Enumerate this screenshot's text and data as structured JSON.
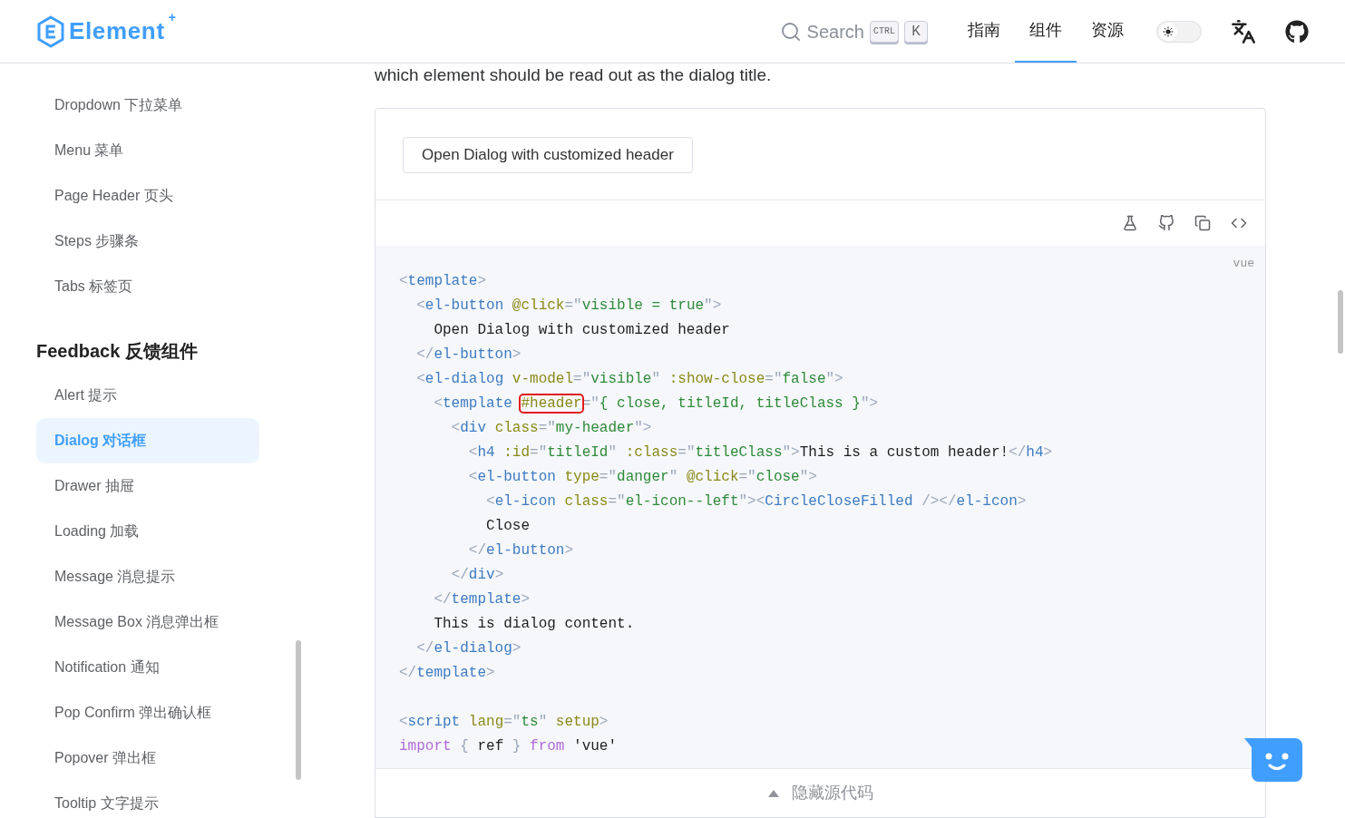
{
  "header": {
    "logo": "Element",
    "logo_mark": "+",
    "search": {
      "label": "Search",
      "keys": [
        "CTRL",
        "K"
      ]
    },
    "nav": [
      {
        "label": "指南",
        "selected": false
      },
      {
        "label": "组件",
        "selected": true
      },
      {
        "label": "资源",
        "selected": false
      }
    ],
    "theme_switch": {
      "on": false
    }
  },
  "sidebar": {
    "sections": [
      {
        "items": [
          {
            "label": "Dropdown 下拉菜单",
            "selected": false
          },
          {
            "label": "Menu 菜单",
            "selected": false
          },
          {
            "label": "Page Header 页头",
            "selected": false
          },
          {
            "label": "Steps 步骤条",
            "selected": false
          },
          {
            "label": "Tabs 标签页",
            "selected": false
          }
        ]
      },
      {
        "title": "Feedback 反馈组件",
        "items": [
          {
            "label": "Alert 提示",
            "selected": false
          },
          {
            "label": "Dialog 对话框",
            "selected": true
          },
          {
            "label": "Drawer 抽屉",
            "selected": false
          },
          {
            "label": "Loading 加载",
            "selected": false
          },
          {
            "label": "Message 消息提示",
            "selected": false
          },
          {
            "label": "Message Box 消息弹出框",
            "selected": false
          },
          {
            "label": "Notification 通知",
            "selected": false
          },
          {
            "label": "Pop Confirm 弹出确认框",
            "selected": false
          },
          {
            "label": "Popover 弹出框",
            "selected": false
          },
          {
            "label": "Tooltip 文字提示",
            "selected": false
          }
        ]
      }
    ]
  },
  "intro": "which element should be read out as the dialog title.",
  "demo": {
    "button": "Open Dialog with customized header",
    "language": "vue",
    "footer": "隐藏源代码",
    "code": [
      {
        "kind": "code",
        "tokens": [
          {
            "kind": "punct",
            "text": "<"
          },
          {
            "kind": "tag",
            "text": "template"
          },
          {
            "kind": "punct",
            "text": ">"
          }
        ]
      },
      {
        "kind": "code",
        "tokens": [
          {
            "kind": "punct",
            "text": "  <"
          },
          {
            "kind": "tag",
            "text": "el-button"
          },
          {
            "kind": "attr",
            "text": " @click"
          },
          {
            "kind": "punct",
            "text": "=\""
          },
          {
            "kind": "string",
            "text": "visible = true"
          },
          {
            "kind": "punct",
            "text": "\">"
          }
        ]
      },
      {
        "kind": "code",
        "tokens": [
          {
            "kind": "text",
            "text": "    Open Dialog with customized header"
          }
        ]
      },
      {
        "kind": "code",
        "tokens": [
          {
            "kind": "punct",
            "text": "  </"
          },
          {
            "kind": "tag",
            "text": "el-button"
          },
          {
            "kind": "punct",
            "text": ">"
          }
        ]
      },
      {
        "kind": "code",
        "tokens": [
          {
            "kind": "punct",
            "text": "  <"
          },
          {
            "kind": "tag",
            "text": "el-dialog"
          },
          {
            "kind": "attr",
            "text": " v-model"
          },
          {
            "kind": "punct",
            "text": "=\""
          },
          {
            "kind": "string",
            "text": "visible"
          },
          {
            "kind": "punct",
            "text": "\""
          },
          {
            "kind": "attr",
            "text": " :show-close"
          },
          {
            "kind": "punct",
            "text": "=\""
          },
          {
            "kind": "string",
            "text": "false"
          },
          {
            "kind": "punct",
            "text": "\">"
          }
        ]
      },
      {
        "kind": "code",
        "tokens": [
          {
            "kind": "punct",
            "text": "    <"
          },
          {
            "kind": "tag",
            "text": "template "
          },
          {
            "kind": "attr",
            "text": "#header",
            "boxed": true
          },
          {
            "kind": "punct",
            "text": "=\""
          },
          {
            "kind": "string",
            "text": "{ close, titleId, titleClass }"
          },
          {
            "kind": "punct",
            "text": "\">"
          }
        ]
      },
      {
        "kind": "code",
        "tokens": [
          {
            "kind": "punct",
            "text": "      <"
          },
          {
            "kind": "tag",
            "text": "div"
          },
          {
            "kind": "attr",
            "text": " class"
          },
          {
            "kind": "punct",
            "text": "=\""
          },
          {
            "kind": "string",
            "text": "my-header"
          },
          {
            "kind": "punct",
            "text": "\">"
          }
        ]
      },
      {
        "kind": "code",
        "tokens": [
          {
            "kind": "punct",
            "text": "        <"
          },
          {
            "kind": "tag",
            "text": "h4"
          },
          {
            "kind": "attr",
            "text": " :id"
          },
          {
            "kind": "punct",
            "text": "=\""
          },
          {
            "kind": "string",
            "text": "titleId"
          },
          {
            "kind": "punct",
            "text": "\""
          },
          {
            "kind": "attr",
            "text": " :class"
          },
          {
            "kind": "punct",
            "text": "=\""
          },
          {
            "kind": "string",
            "text": "titleClass"
          },
          {
            "kind": "punct",
            "text": "\">"
          },
          {
            "kind": "text",
            "text": "This is a custom header!"
          },
          {
            "kind": "punct",
            "text": "</"
          },
          {
            "kind": "tag",
            "text": "h4"
          },
          {
            "kind": "punct",
            "text": ">"
          }
        ]
      },
      {
        "kind": "code",
        "tokens": [
          {
            "kind": "punct",
            "text": "        <"
          },
          {
            "kind": "tag",
            "text": "el-button"
          },
          {
            "kind": "attr",
            "text": " type"
          },
          {
            "kind": "punct",
            "text": "=\""
          },
          {
            "kind": "string",
            "text": "danger"
          },
          {
            "kind": "punct",
            "text": "\""
          },
          {
            "kind": "attr",
            "text": " @click"
          },
          {
            "kind": "punct",
            "text": "=\""
          },
          {
            "kind": "string",
            "text": "close"
          },
          {
            "kind": "punct",
            "text": "\">"
          }
        ]
      },
      {
        "kind": "code",
        "tokens": [
          {
            "kind": "punct",
            "text": "          <"
          },
          {
            "kind": "tag",
            "text": "el-icon"
          },
          {
            "kind": "attr",
            "text": " class"
          },
          {
            "kind": "punct",
            "text": "=\""
          },
          {
            "kind": "string",
            "text": "el-icon--left"
          },
          {
            "kind": "punct",
            "text": "\"><"
          },
          {
            "kind": "tag",
            "text": "CircleCloseFilled"
          },
          {
            "kind": "punct",
            "text": " /></"
          },
          {
            "kind": "tag",
            "text": "el-icon"
          },
          {
            "kind": "punct",
            "text": ">"
          }
        ]
      },
      {
        "kind": "code",
        "tokens": [
          {
            "kind": "text",
            "text": "          Close"
          }
        ]
      },
      {
        "kind": "code",
        "tokens": [
          {
            "kind": "punct",
            "text": "        </"
          },
          {
            "kind": "tag",
            "text": "el-button"
          },
          {
            "kind": "punct",
            "text": ">"
          }
        ]
      },
      {
        "kind": "code",
        "tokens": [
          {
            "kind": "punct",
            "text": "      </"
          },
          {
            "kind": "tag",
            "text": "div"
          },
          {
            "kind": "punct",
            "text": ">"
          }
        ]
      },
      {
        "kind": "code",
        "tokens": [
          {
            "kind": "punct",
            "text": "    </"
          },
          {
            "kind": "tag",
            "text": "template"
          },
          {
            "kind": "punct",
            "text": ">"
          }
        ]
      },
      {
        "kind": "code",
        "tokens": [
          {
            "kind": "text",
            "text": "    This is dialog content."
          }
        ]
      },
      {
        "kind": "code",
        "tokens": [
          {
            "kind": "punct",
            "text": "  </"
          },
          {
            "kind": "tag",
            "text": "el-dialog"
          },
          {
            "kind": "punct",
            "text": ">"
          }
        ]
      },
      {
        "kind": "code",
        "tokens": [
          {
            "kind": "punct",
            "text": "</"
          },
          {
            "kind": "tag",
            "text": "template"
          },
          {
            "kind": "punct",
            "text": ">"
          }
        ]
      },
      {
        "kind": "blank"
      },
      {
        "kind": "code",
        "tokens": [
          {
            "kind": "punct",
            "text": "<"
          },
          {
            "kind": "tag",
            "text": "script"
          },
          {
            "kind": "attr",
            "text": " lang"
          },
          {
            "kind": "punct",
            "text": "=\""
          },
          {
            "kind": "string",
            "text": "ts"
          },
          {
            "kind": "punct",
            "text": "\""
          },
          {
            "kind": "attr",
            "text": " setup"
          },
          {
            "kind": "punct",
            "text": ">"
          }
        ]
      },
      {
        "kind": "code",
        "tokens": [
          {
            "kind": "keyword",
            "text": "import"
          },
          {
            "kind": "punct",
            "text": " { "
          },
          {
            "kind": "text",
            "text": "ref"
          },
          {
            "kind": "punct",
            "text": " } "
          },
          {
            "kind": "keyword",
            "text": "from"
          },
          {
            "kind": "text",
            "text": " 'vue'"
          }
        ]
      }
    ]
  }
}
